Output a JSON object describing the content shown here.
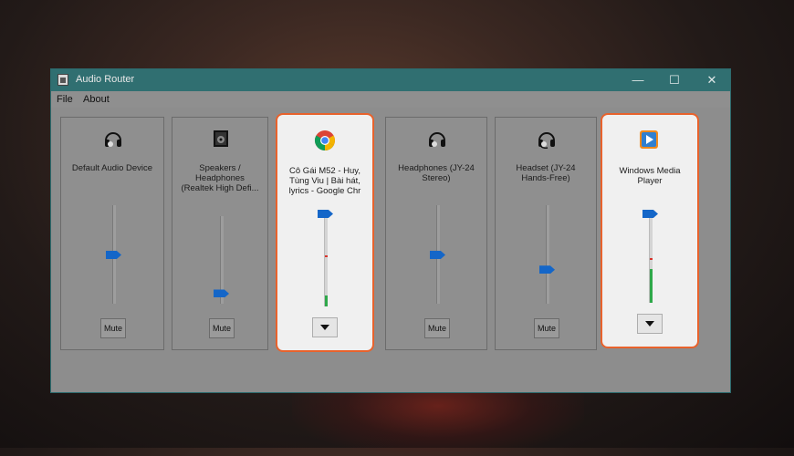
{
  "window": {
    "title": "Audio Router",
    "controls": {
      "minimize": "—",
      "maximize": "☐",
      "close": "✕"
    }
  },
  "menu": {
    "file": "File",
    "about": "About"
  },
  "panels": [
    {
      "name": "Default Audio Device",
      "icon": "headphones-icon",
      "control_label": "Mute",
      "highlighted": false,
      "volume": 0.5
    },
    {
      "name": "Speakers /\nHeadphones\n(Realtek High Defi...",
      "icon": "speaker-icon",
      "control_label": "Mute",
      "highlighted": false,
      "volume": 0.12
    },
    {
      "name": "Cô Gái M52 - Huy,\nTùng Viu | Bài hát,\nlyrics - Google Chr",
      "icon": "chrome-icon",
      "control_label": "▼",
      "highlighted": true,
      "volume": 1.0,
      "level": 0.12,
      "peak": 0.55
    },
    {
      "name": "Headphones (JY-24\nStereo)",
      "icon": "headphones-icon",
      "control_label": "Mute",
      "highlighted": false,
      "volume": 0.5
    },
    {
      "name": "Headset (JY-24\nHands-Free)",
      "icon": "headset-icon",
      "control_label": "Mute",
      "highlighted": false,
      "volume": 0.35
    },
    {
      "name": "Windows Media\nPlayer",
      "icon": "windows-media-player-icon",
      "control_label": "▼",
      "highlighted": true,
      "volume": 1.0,
      "level": 0.38,
      "peak": 0.5
    }
  ],
  "colors": {
    "titlebar": "#306f71",
    "highlight_border": "#e8622c",
    "thumb": "#1466c8",
    "level": "#2fa84a"
  }
}
